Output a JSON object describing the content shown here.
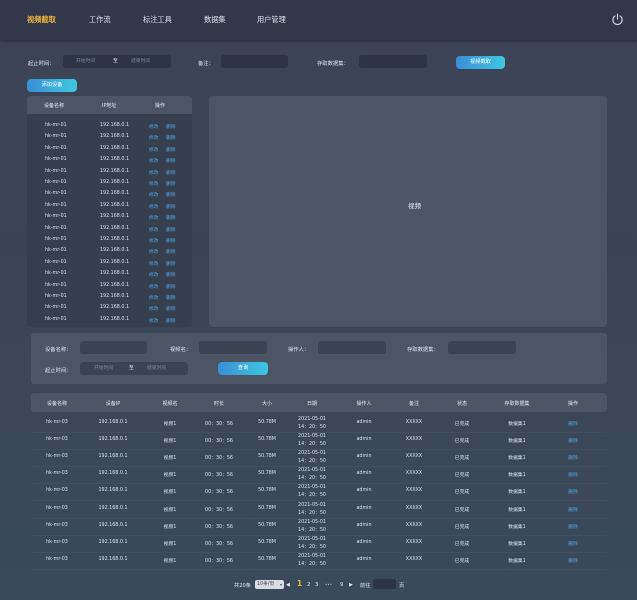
{
  "nav": {
    "items": [
      "视频截取",
      "工作流",
      "标注工具",
      "数据集",
      "用户管理"
    ]
  },
  "colors": {
    "accent": "#f1b43c",
    "link": "#4ea3e8",
    "button_start": "#3a8fd6",
    "button_end": "#3ec7e0"
  },
  "filter1": {
    "start_label": "起止时间：",
    "start_placeholder": "开始时间",
    "to": "至",
    "end_placeholder": "结束时间",
    "note_label": "备注：",
    "dataset_label": "存取数据集：",
    "capture_button": "视频截取"
  },
  "add_device_button": "添加设备",
  "device_table": {
    "headers": [
      "设备名称",
      "IP地址",
      "操作"
    ],
    "rows": [
      {
        "name": "hk-mr-01",
        "ip": "192.168.0.1"
      },
      {
        "name": "hk-mr-01",
        "ip": "192.168.0.1"
      },
      {
        "name": "hk-mr-01",
        "ip": "192.168.0.1"
      },
      {
        "name": "hk-mr-01",
        "ip": "192.168.0.1"
      },
      {
        "name": "hk-mr-01",
        "ip": "192.168.0.1"
      },
      {
        "name": "hk-mr-01",
        "ip": "192.168.0.1"
      },
      {
        "name": "hk-mr-01",
        "ip": "192.168.0.1"
      },
      {
        "name": "hk-mr-01",
        "ip": "192.168.0.1"
      },
      {
        "name": "hk-mr-01",
        "ip": "192.168.0.1"
      },
      {
        "name": "hk-mr-01",
        "ip": "192.168.0.1"
      },
      {
        "name": "hk-mr-01",
        "ip": "192.168.0.1"
      },
      {
        "name": "hk-mr-01",
        "ip": "192.168.0.1"
      },
      {
        "name": "hk-mr-01",
        "ip": "192.168.0.1"
      },
      {
        "name": "hk-mr-01",
        "ip": "192.168.0.1"
      },
      {
        "name": "hk-mr-01",
        "ip": "192.168.0.1"
      },
      {
        "name": "hk-mr-01",
        "ip": "192.168.0.1"
      },
      {
        "name": "hk-mr-01",
        "ip": "192.168.0.1"
      },
      {
        "name": "hk-mr-01",
        "ip": "192.168.0.1"
      }
    ],
    "edit_label": "修改",
    "delete_label": "删除"
  },
  "video_panel": {
    "label": "视频"
  },
  "filter2": {
    "device_label": "设备名称：",
    "video_label": "视频名：",
    "operator_label": "操作人：",
    "dataset_label": "存取数据集：",
    "start_label": "起止时间：",
    "start_placeholder": "开始时间",
    "to": "至",
    "end_placeholder": "结束时间",
    "query_button": "查询"
  },
  "record_table": {
    "headers": [
      "设备名称",
      "设备IP",
      "视频名",
      "时长",
      "大小",
      "日期",
      "操作人",
      "备注",
      "状态",
      "存取数据集",
      "操作"
    ],
    "rows": [
      {
        "device": "hk-mr-03",
        "ip": "192.168.0.1",
        "video": "视频1",
        "duration": "00：30：56",
        "size": "50.78M",
        "date1": "2021-05-01",
        "date2": "14：20：50",
        "operator": "admin",
        "note": "XXXXX",
        "status": "已完成",
        "dataset": "数据集1",
        "action": "删除"
      },
      {
        "device": "hk-mr-03",
        "ip": "192.168.0.1",
        "video": "视频1",
        "duration": "00：30：56",
        "size": "50.78M",
        "date1": "2021-05-01",
        "date2": "14：20：50",
        "operator": "admin",
        "note": "XXXXX",
        "status": "已完成",
        "dataset": "数据集1",
        "action": "删除"
      },
      {
        "device": "hk-mr-03",
        "ip": "192.168.0.1",
        "video": "视频1",
        "duration": "00：30：56",
        "size": "50.78M",
        "date1": "2021-05-01",
        "date2": "14：20：50",
        "operator": "admin",
        "note": "XXXXX",
        "status": "已完成",
        "dataset": "数据集1",
        "action": "删除"
      },
      {
        "device": "hk-mr-03",
        "ip": "192.168.0.1",
        "video": "视频1",
        "duration": "00：30：56",
        "size": "50.78M",
        "date1": "2021-05-01",
        "date2": "14：20：50",
        "operator": "admin",
        "note": "XXXXX",
        "status": "已完成",
        "dataset": "数据集1",
        "action": "删除"
      },
      {
        "device": "hk-mr-03",
        "ip": "192.168.0.1",
        "video": "视频1",
        "duration": "00：30：56",
        "size": "50.78M",
        "date1": "2021-05-01",
        "date2": "14：20：50",
        "operator": "admin",
        "note": "XXXXX",
        "status": "已完成",
        "dataset": "数据集1",
        "action": "删除"
      },
      {
        "device": "hk-mr-03",
        "ip": "192.168.0.1",
        "video": "视频1",
        "duration": "00：30：56",
        "size": "50.78M",
        "date1": "2021-05-01",
        "date2": "14：20：50",
        "operator": "admin",
        "note": "XXXXX",
        "status": "已完成",
        "dataset": "数据集1",
        "action": "删除"
      },
      {
        "device": "hk-mr-03",
        "ip": "192.168.0.1",
        "video": "视频1",
        "duration": "00：30：56",
        "size": "50.78M",
        "date1": "2021-05-01",
        "date2": "14：20：50",
        "operator": "admin",
        "note": "XXXXX",
        "status": "已完成",
        "dataset": "数据集1",
        "action": "删除"
      },
      {
        "device": "hk-mr-03",
        "ip": "192.168.0.1",
        "video": "视频1",
        "duration": "00：30：56",
        "size": "50.78M",
        "date1": "2021-05-01",
        "date2": "14：20：50",
        "operator": "admin",
        "note": "XXXXX",
        "status": "已完成",
        "dataset": "数据集1",
        "action": "删除"
      },
      {
        "device": "hk-mr-03",
        "ip": "192.168.0.1",
        "video": "视频1",
        "duration": "00：30：56",
        "size": "50.78M",
        "date1": "2021-05-01",
        "date2": "14：20：50",
        "operator": "admin",
        "note": "XXXXX",
        "status": "已完成",
        "dataset": "数据集1",
        "action": "删除"
      }
    ]
  },
  "pagination": {
    "total": "共20条",
    "page_size": "10条/页",
    "prev": "◀",
    "pages": [
      "1",
      "2",
      "3"
    ],
    "ellipsis": "•••",
    "last": "9",
    "next": "▶",
    "goto_label": "前往",
    "page_suffix": "页"
  }
}
